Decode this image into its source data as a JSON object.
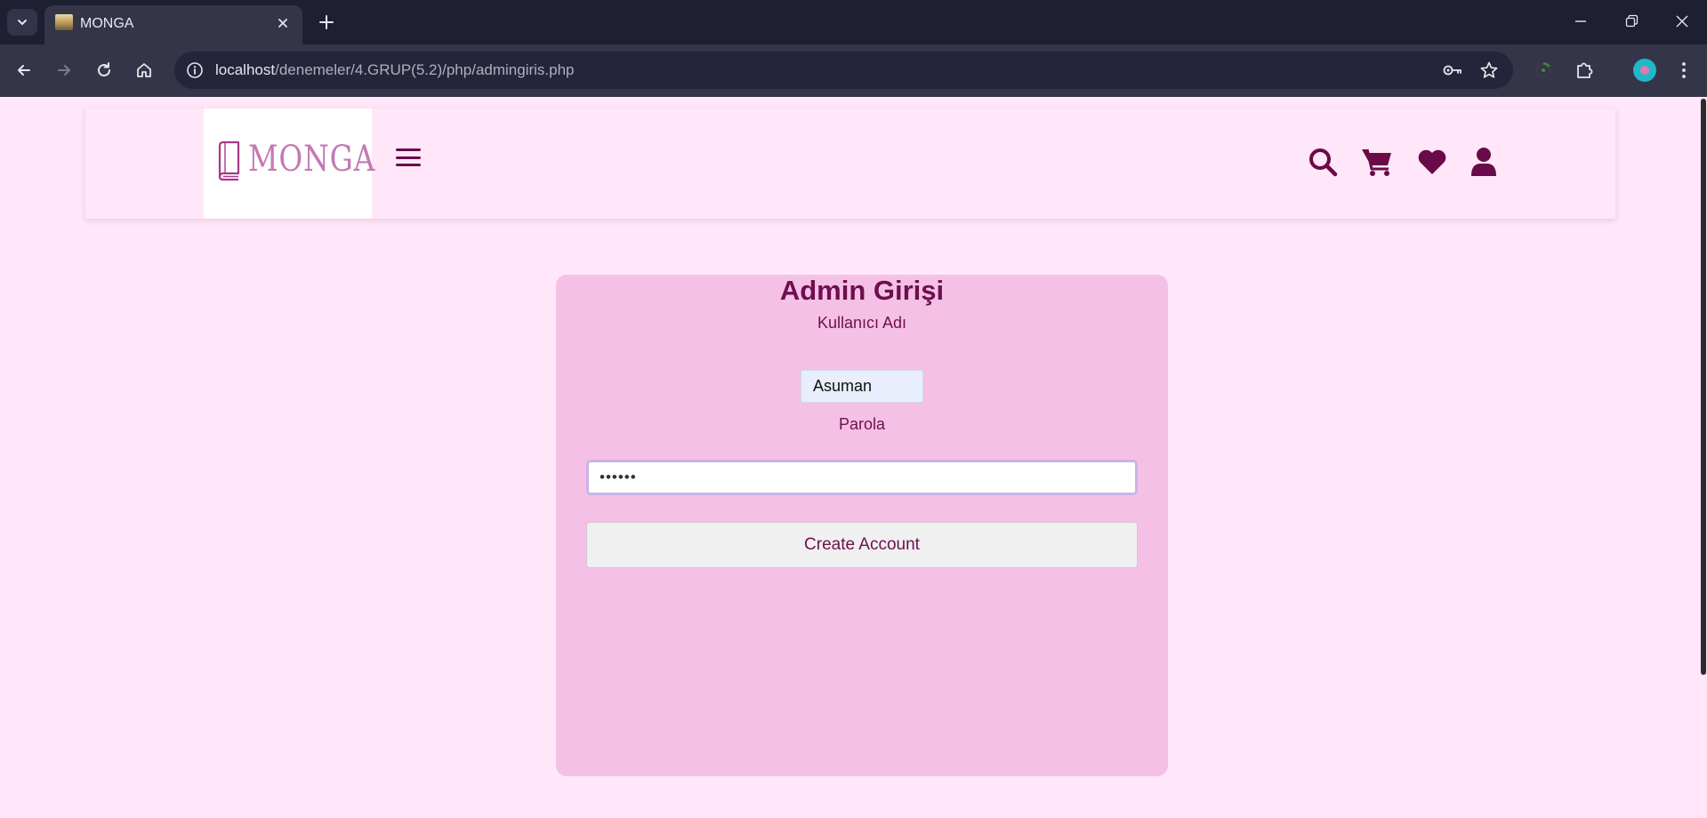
{
  "browser": {
    "tab_title": "MONGA",
    "url_host": "localhost",
    "url_path": "/denemeler/4.GRUP(5.2)/php/admingiris.php"
  },
  "site": {
    "logo_text": "MONGA",
    "header_icons": [
      "search-icon",
      "cart-icon",
      "heart-icon",
      "user-icon"
    ]
  },
  "login": {
    "title": "Admin Girişi",
    "username_label": "Kullanıcı Adı",
    "username_value": "Asuman",
    "password_label": "Parola",
    "password_mask": "••••••",
    "submit_label": "Create Account"
  },
  "colors": {
    "page_bg": "#ffe6f8",
    "card_bg": "#f5c0e6",
    "accent": "#6d0f4e",
    "logo": "#c37ab4"
  }
}
